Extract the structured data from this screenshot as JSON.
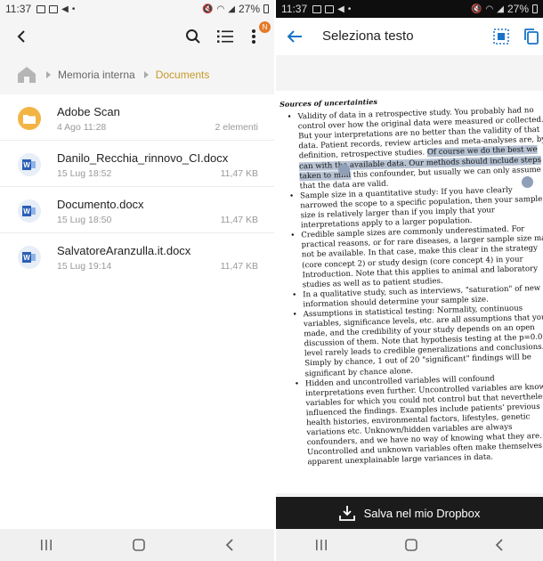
{
  "left": {
    "status": {
      "time": "11:37",
      "battery": "27%"
    },
    "breadcrumb": {
      "root": "Memoria interna",
      "current": "Documents"
    },
    "menu_badge": "N",
    "files": [
      {
        "name": "Adobe Scan",
        "date": "4 Ago 11:28",
        "size": "2 elementi",
        "type": "folder"
      },
      {
        "name": "Danilo_Recchia_rinnovo_CI.docx",
        "date": "15 Lug 18:52",
        "size": "11,47 KB",
        "type": "word"
      },
      {
        "name": "Documento.docx",
        "date": "15 Lug 18:50",
        "size": "11,47 KB",
        "type": "word"
      },
      {
        "name": "SalvatoreAranzulla.it.docx",
        "date": "15 Lug 19:14",
        "size": "11,47 KB",
        "type": "word"
      }
    ]
  },
  "right": {
    "status": {
      "time": "11:37",
      "battery": "27%"
    },
    "title": "Seleziona testo",
    "save_label": "Salva nel mio Dropbox",
    "doc": {
      "heading": "Sources of uncertainties",
      "b1_pre": "Validity of data in a retrospective study. You probably had no control over how the original data were measured or collected. But your interpretations are no better than the validity of that data. Patient records, review articles and meta-analyses are, by definition, retrospective studies. ",
      "b1_hl": "Of course we do the best we can with the available data. Our methods should include steps taken to mini",
      "b1_post": " this confounder, but usually we can only assume that the data are valid.",
      "b2": "Sample size in a quantitative study: If you have clearly narrowed the scope to a specific population, then your sample size is relatively larger than if you imply that your interpretations apply to a larger population.",
      "b3": "Credible sample sizes are commonly underestimated. For practical reasons, or for rare diseases, a larger sample size may not be available. In that case, make this clear in the strategy (core concept 2) or study design (core concept 4) in your Introduction. Note that this applies to animal and laboratory studies as well as to patient studies.",
      "b4": "In a qualitative study, such as interviews, \"saturation\" of new information should determine your sample size.",
      "b5": "Assumptions in statistical testing: Normality, continuous variables, significance levels, etc. are all assumptions that you made, and the credibility of your study depends on an open discussion of them. Note that hypothesis testing at the p=0.05 level rarely leads to credible generalizations and conclusions. Simply by chance, 1 out of 20 \"significant\" findings will be significant by chance alone.",
      "b6": "Hidden and uncontrolled variables will confound interpretations even further. Uncontrolled variables are known variables for which you could not control but that nevertheless influenced the findings. Examples include patients' previous health histories, environmental factors, lifestyles, genetic variations etc. Unknown/hidden variables are always confounders, and we have no way of knowing what they are. Uncontrolled and unknown variables often make themselves apparent unexplainable large variances in data."
    }
  },
  "colors": {
    "accent_blue": "#1a73c8",
    "folder": "#f2b544",
    "breadcrumb_active": "#c79a2a",
    "highlight": "#b7c3d3"
  }
}
